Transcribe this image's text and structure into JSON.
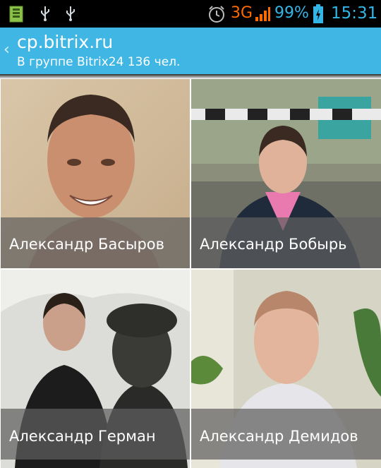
{
  "status_bar": {
    "network": "3G",
    "battery": "99%",
    "time": "15:31",
    "icons": [
      "sd-card-icon",
      "usb-icon",
      "usb-icon",
      "alarm-icon",
      "signal-icon",
      "battery-icon"
    ],
    "accent": "#33b5e5",
    "network_color": "#ff6a00"
  },
  "action_bar": {
    "title": "cp.bitrix.ru",
    "subtitle": "В группе Bitrix24 136 чел.",
    "color": "#3fb6e3"
  },
  "members": [
    {
      "name": "Александр Басыров"
    },
    {
      "name": "Александр Бобырь"
    },
    {
      "name": "Александр Герман"
    },
    {
      "name": "Александр Демидов"
    }
  ]
}
